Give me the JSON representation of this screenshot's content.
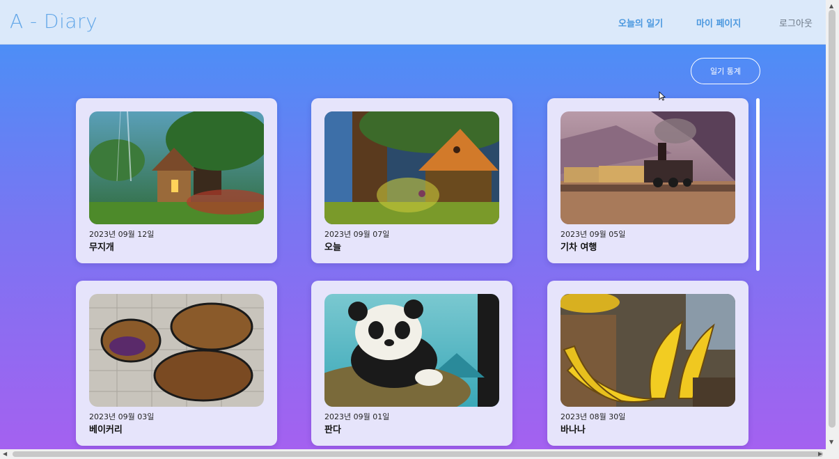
{
  "header": {
    "logo": "A - Diary",
    "nav": {
      "today": "오늘의 일기",
      "mypage": "마이 페이지",
      "logout": "로그아웃"
    }
  },
  "main": {
    "stats_button": "일기 통계",
    "cards": [
      {
        "date": "2023년 09월 12일",
        "title": "무지개",
        "image": "fantasy-forest-cottage-image"
      },
      {
        "date": "2023년 09월 07일",
        "title": "오늘",
        "image": "rainy-tree-house-image"
      },
      {
        "date": "2023년 09월 05일",
        "title": "기차 여행",
        "image": "steam-train-image"
      },
      {
        "date": "2023년 09월 03일",
        "title": "베이커리",
        "image": "bakery-cookies-image"
      },
      {
        "date": "2023년 09월 01일",
        "title": "판다",
        "image": "panda-image"
      },
      {
        "date": "2023년 08월 30일",
        "title": "바나나",
        "image": "bananas-image"
      }
    ]
  },
  "colors": {
    "header_bg": "#dbe9fa",
    "accent": "#4b98df",
    "gradient_top": "#4d8ef6",
    "gradient_bottom": "#a461f0",
    "card_bg": "#e6e4fb"
  }
}
